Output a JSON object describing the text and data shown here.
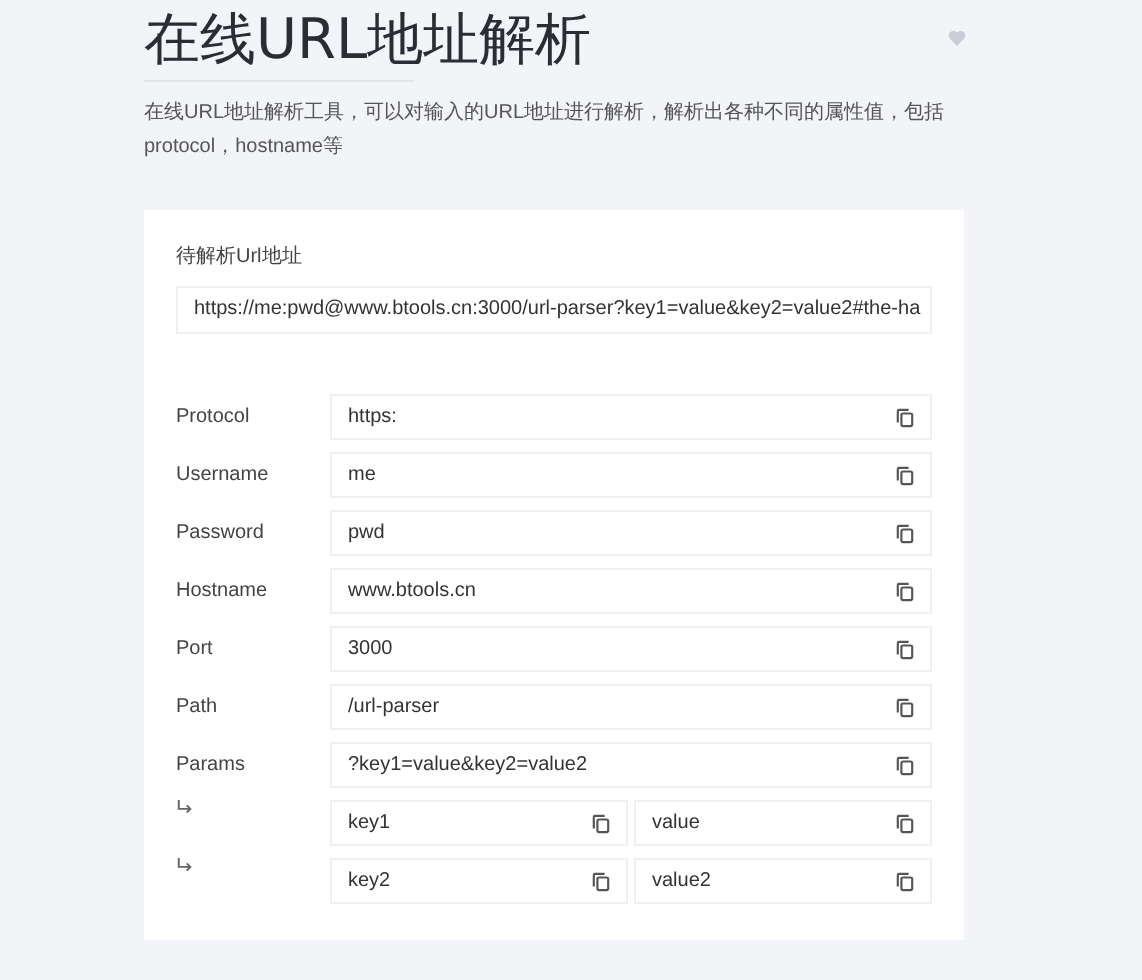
{
  "title": "在线URL地址解析",
  "description": "在线URL地址解析工具，可以对输入的URL地址进行解析，解析出各种不同的属性值，包括protocol，hostname等",
  "input": {
    "label": "待解析Url地址",
    "value": "https://me:pwd@www.btools.cn:3000/url-parser?key1=value&key2=value2#the-ha"
  },
  "fields": [
    {
      "kind": "field",
      "label": "Protocol",
      "value": "https:"
    },
    {
      "kind": "field",
      "label": "Username",
      "value": "me"
    },
    {
      "kind": "field",
      "label": "Password",
      "value": "pwd"
    },
    {
      "kind": "field",
      "label": "Hostname",
      "value": "www.btools.cn"
    },
    {
      "kind": "field",
      "label": "Port",
      "value": "3000"
    },
    {
      "kind": "field",
      "label": "Path",
      "value": "/url-parser"
    },
    {
      "kind": "field",
      "label": "Params",
      "value": "?key1=value&key2=value2"
    },
    {
      "kind": "pair",
      "key": "key1",
      "value": "value"
    },
    {
      "kind": "pair",
      "key": "key2",
      "value": "value2"
    }
  ]
}
